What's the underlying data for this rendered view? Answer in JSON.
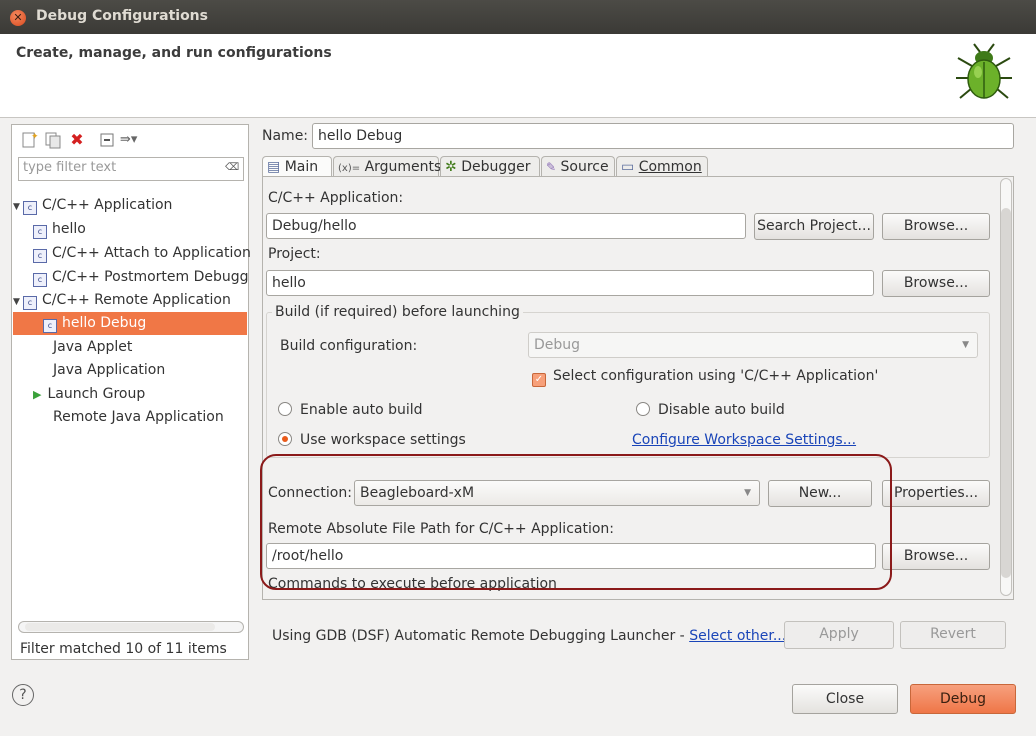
{
  "window": {
    "title": "Debug Configurations"
  },
  "header": {
    "title": "Create, manage, and run configurations",
    "logo_icon": "bug-icon"
  },
  "left": {
    "toolbar_icons": [
      "new-configuration-icon",
      "duplicate-icon",
      "delete-icon",
      "collapse-all-icon",
      "filter-icon"
    ],
    "filter_placeholder": "type filter text",
    "tree": [
      {
        "label": "C/C++ Application",
        "expanded": true
      },
      {
        "label": "hello"
      },
      {
        "label": "C/C++ Attach to Application"
      },
      {
        "label": "C/C++ Postmortem Debugg"
      },
      {
        "label": "C/C++ Remote Application",
        "expanded": true
      },
      {
        "label": "hello Debug",
        "selected": true
      },
      {
        "label": "Java Applet"
      },
      {
        "label": "Java Application"
      },
      {
        "label": "Launch Group"
      },
      {
        "label": "Remote Java Application"
      }
    ],
    "status": "Filter matched 10 of 11 items"
  },
  "main": {
    "name_label": "Name:",
    "name_value": "hello Debug",
    "tabs": [
      {
        "label": "Main",
        "icon": "main-tab-icon",
        "active": true
      },
      {
        "label": "Arguments",
        "icon": "arguments-icon"
      },
      {
        "label": "Debugger",
        "icon": "debugger-icon"
      },
      {
        "label": "Source",
        "icon": "source-icon"
      },
      {
        "label": "Common",
        "icon": "common-icon"
      }
    ],
    "app_label": "C/C++ Application:",
    "app_value": "Debug/hello",
    "search_project": "Search Project...",
    "browse": "Browse...",
    "project_label": "Project:",
    "project_value": "hello",
    "build_group_title": "Build (if required) before launching",
    "build_config_label": "Build configuration:",
    "build_config_value": "Debug",
    "select_config_check": "Select configuration using 'C/C++ Application'",
    "enable_auto_build": "Enable auto build",
    "disable_auto_build": "Disable auto build",
    "use_workspace": "Use workspace settings",
    "configure_workspace": "Configure Workspace Settings...",
    "connection_label": "Connection:",
    "connection_value": "Beagleboard-xM",
    "new_btn": "New...",
    "properties_btn": "Properties...",
    "remote_path_label": "Remote Absolute File Path for C/C++ Application:",
    "remote_path_value": "/root/hello",
    "commands_label": "Commands to execute before application"
  },
  "footer": {
    "launcher_text": "Using GDB (DSF) Automatic Remote Debugging Launcher - ",
    "select_other": "Select other...",
    "apply": "Apply",
    "revert": "Revert",
    "close": "Close",
    "debug": "Debug",
    "help_icon": "help-icon"
  },
  "colors": {
    "accent": "#f07746",
    "highlight_ring": "#8b1a1a",
    "link": "#1a45b8"
  }
}
